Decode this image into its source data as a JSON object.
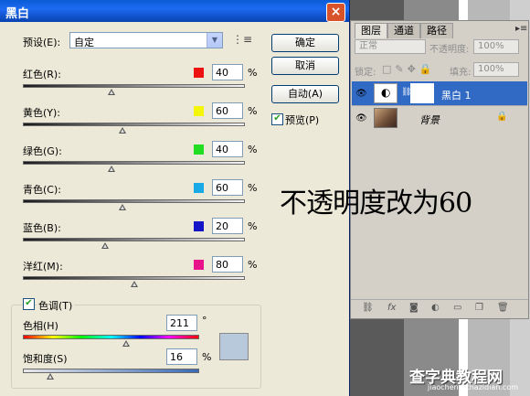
{
  "dialog": {
    "title": "黑白",
    "close_glyph": "×",
    "preset_label": "预设(E):",
    "preset_value": "自定",
    "buttons": {
      "ok": "确定",
      "cancel": "取消",
      "auto": "自动(A)"
    },
    "preview_label": "预览(P)",
    "sliders": [
      {
        "label": "红色(R):",
        "value": "40",
        "unit": "%",
        "color": "#ee1111",
        "level": 0.4
      },
      {
        "label": "黄色(Y):",
        "value": "60",
        "unit": "%",
        "color": "#f5f50a",
        "level": 0.45
      },
      {
        "label": "绿色(G):",
        "value": "40",
        "unit": "%",
        "color": "#22dd22",
        "level": 0.4
      },
      {
        "label": "青色(C):",
        "value": "60",
        "unit": "%",
        "color": "#19a9e6",
        "level": 0.45
      },
      {
        "label": "蓝色(B):",
        "value": "20",
        "unit": "%",
        "color": "#1515c8",
        "level": 0.37
      },
      {
        "label": "洋红(M):",
        "value": "80",
        "unit": "%",
        "color": "#e8158a",
        "level": 0.5
      }
    ],
    "tint": {
      "label": "色调(T)",
      "hue_label": "色相(H)",
      "hue_value": "211",
      "hue_unit": "°",
      "sat_label": "饱和度(S)",
      "sat_value": "16",
      "sat_unit": "%",
      "swatch_color": "#b8c9dc"
    }
  },
  "layers": {
    "tabs": [
      "图层",
      "通道",
      "路径"
    ],
    "blend_mode": "正常",
    "opacity_label": "不透明度:",
    "opacity_value": "100%",
    "lock_label": "锁定:",
    "fill_label": "填充:",
    "fill_value": "100%",
    "items": [
      {
        "name": "黑白 1",
        "selected": true
      },
      {
        "name": "背景",
        "selected": false
      }
    ]
  },
  "annotation": "不透明度改为60",
  "watermark": {
    "main": "查字典教程网",
    "sub": "jiaocheng.chazidian.com"
  }
}
